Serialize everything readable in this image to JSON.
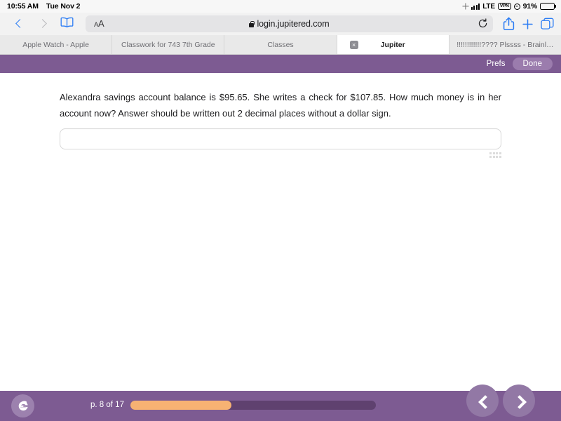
{
  "status_bar": {
    "time": "10:55 AM",
    "date": "Tue Nov 2",
    "location_icon": "location-arrow-icon",
    "signal_icon": "cellular-signal-icon",
    "network": "LTE",
    "vpn_badge": "VPN",
    "focus_icon": "target-icon",
    "battery_percent": "91%",
    "battery_icon": "battery-icon"
  },
  "toolbar": {
    "back_icon": "back-chevron-icon",
    "forward_icon": "forward-chevron-icon",
    "bookmarks_icon": "book-icon",
    "text_size_label": "AA",
    "lock_icon": "lock-icon",
    "url": "login.jupitered.com",
    "reload_icon": "reload-icon",
    "share_icon": "share-icon",
    "new_tab_icon": "plus-icon",
    "tabs_icon": "tabs-overview-icon"
  },
  "tabs": [
    {
      "label": "Apple Watch - Apple",
      "active": false
    },
    {
      "label": "Classwork for 743 7th Grade",
      "active": false
    },
    {
      "label": "Classes",
      "active": false
    },
    {
      "label": "Jupiter",
      "active": true,
      "close_label": "×"
    },
    {
      "label": "!!!!!!!!!!!!???? Plssss - Brainl…",
      "active": false
    }
  ],
  "app_header": {
    "prefs_label": "Prefs",
    "done_label": "Done",
    "background_color": "#7d5b92",
    "done_button_color": "#9b7cad"
  },
  "main": {
    "question_text": "Alexandra savings account balance is $95.65. She writes a check for $107.85. How much money is in her account now? Answer should be written out 2 decimal places without a dollar sign.",
    "answer_value": "",
    "answer_placeholder": "",
    "resize_handle": "resize-grip-icon"
  },
  "bottom_bar": {
    "logo_icon": "jupiter-logo-icon",
    "page_label": "p. 8 of 17",
    "progress_percent": 41,
    "progress_fill_color": "#f7b273",
    "progress_track_color": "#5f416f",
    "prev_icon": "chevron-left-icon",
    "next_icon": "chevron-right-icon"
  }
}
